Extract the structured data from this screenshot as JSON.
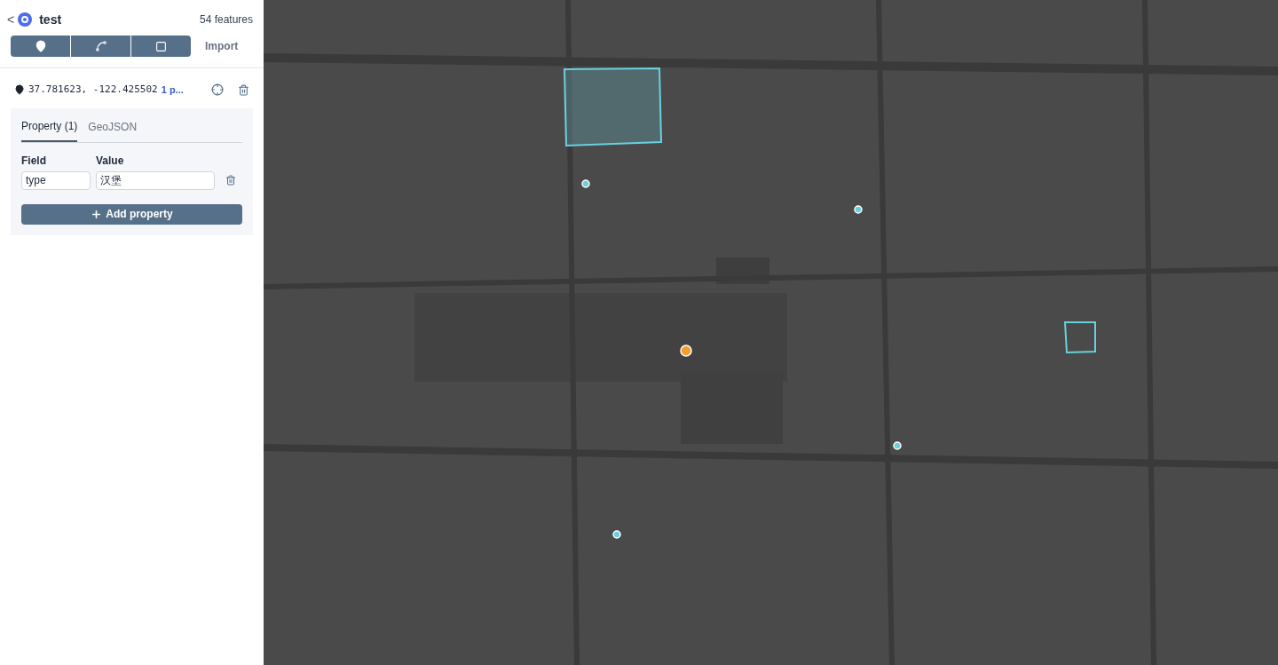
{
  "header": {
    "back": "<",
    "title": "test",
    "count": "54 features"
  },
  "tools": [
    {
      "kind": "marker"
    },
    {
      "kind": "line"
    },
    {
      "kind": "polygon"
    }
  ],
  "import": "Import",
  "feature": {
    "coords": "37.781623, -122.425502",
    "extra": "1 p..."
  },
  "tabs": [
    {
      "label": "Property (1)",
      "selected": true
    },
    {
      "label": "GeoJSON",
      "selected": false
    }
  ],
  "columns": [
    "Field",
    "Value"
  ],
  "properties": [
    {
      "field": "type",
      "value": "汉堡"
    }
  ],
  "add_button": "Add property",
  "map": {
    "kind": "picture"
  }
}
